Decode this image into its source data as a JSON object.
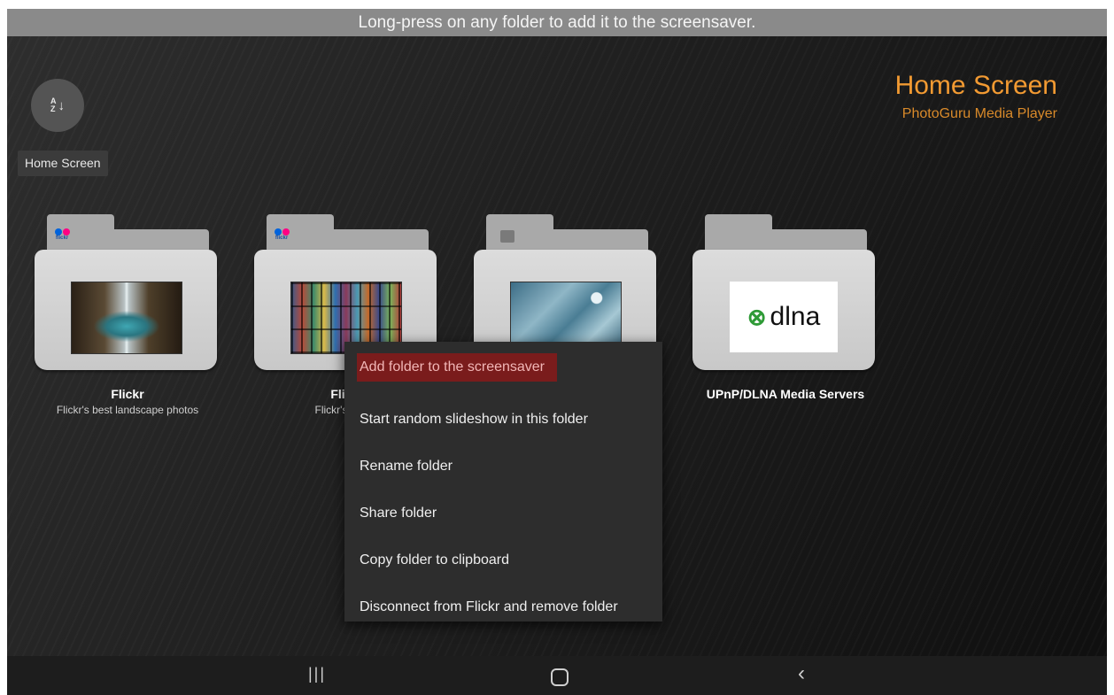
{
  "hint": "Long-press on any folder to add it to the screensaver.",
  "sort_button": {
    "icon": "sort-alpha-icon",
    "glyph_top": "A",
    "glyph_bottom": "Z",
    "arrow": "↓"
  },
  "tooltip": "Home Screen",
  "header": {
    "title": "Home Screen",
    "subtitle": "PhotoGuru Media Player"
  },
  "colors": {
    "accent": "#f29a32",
    "menu_highlight": "#7a1c1c"
  },
  "folders": [
    {
      "label": "Flickr",
      "sublabel": "Flickr's best landscape photos",
      "badge": "flickr"
    },
    {
      "label": "Flickr",
      "sublabel": "Flickr's gold a",
      "badge": "flickr"
    },
    {
      "label": "",
      "sublabel": "",
      "badge": "server-icon"
    },
    {
      "label": "UPnP/DLNA Media Servers",
      "sublabel": "",
      "badge": ""
    }
  ],
  "flickr_badge_text": "flickr",
  "dlna_text": "dlna",
  "context_menu": {
    "items": [
      "Add folder to the screensaver",
      "Start random slideshow in this folder",
      "Rename folder",
      "Share folder",
      "Copy folder to clipboard",
      "Disconnect from Flickr and remove folder"
    ],
    "highlighted_index": 0
  },
  "navbar": {
    "recents": "|||",
    "back": "‹"
  }
}
